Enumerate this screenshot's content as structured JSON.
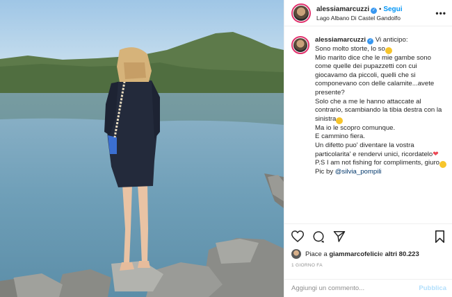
{
  "post": {
    "username": "alessiamarcuzzi",
    "follow_label": "Segui",
    "separator": "•",
    "location": "Lago Albano Di Castel Gandolfo",
    "more_label": "•••",
    "photo_alt": ""
  },
  "caption": {
    "lines": [
      "Vi anticipo:",
      "Sono molto storte, lo so",
      "Mio marito dice che le mie gambe sono come quelle dei pupazzetti con cui giocavamo da piccoli, quelli che si componevano con delle calamite...avete presente?",
      "Solo che a me le hanno attaccate al contrario, scambiando la tibia destra con la sinistra",
      "Ma io le scopro comunque.",
      "E cammino fiera.",
      "Un difetto puo' diventare la vostra particolarita' e rendervi unici, ricordatelo",
      "P.S I am not fishing for compliments, giuro",
      "Pic by "
    ],
    "mention": "@silvia_pompili"
  },
  "actions": {
    "icons": [
      "heart-icon",
      "comment-icon",
      "share-icon",
      "bookmark-icon"
    ]
  },
  "likes": {
    "prefix": "Piace a ",
    "user": "giammarcofelici",
    "suffix": " e ",
    "others": "altri 80.223"
  },
  "timestamp": "1 GIORNO FA",
  "comment_box": {
    "placeholder": "Aggiungi un commento...",
    "publish_label": "Pubblica"
  },
  "colors": {
    "link_blue": "#0095f6",
    "verified_blue": "#3897f0",
    "border": "#efefef",
    "muted": "#8e8e8e"
  }
}
